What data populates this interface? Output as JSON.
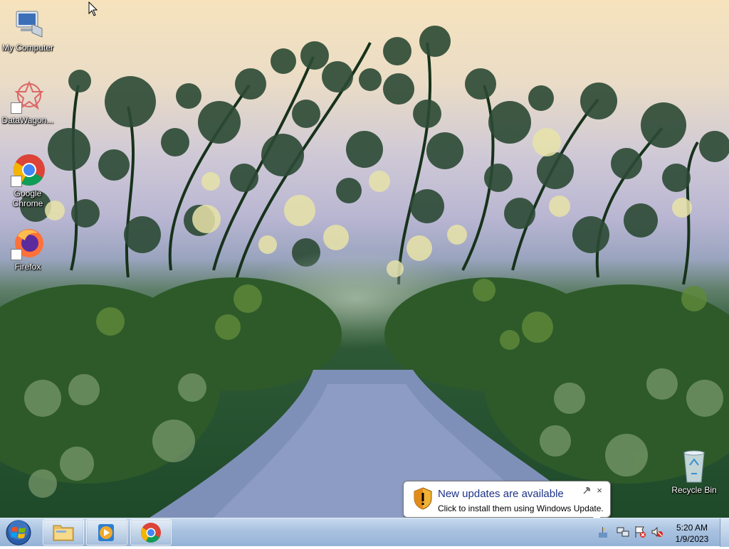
{
  "desktop": {
    "icons": [
      {
        "label": "My Computer",
        "icon": "computer-icon"
      },
      {
        "label": "DataWagon...",
        "icon": "datawagon-icon"
      },
      {
        "label": "Google Chrome",
        "icon": "chrome-icon"
      },
      {
        "label": "Firefox",
        "icon": "firefox-icon"
      },
      {
        "label": "Recycle Bin",
        "icon": "recycle-bin-icon"
      }
    ]
  },
  "taskbar": {
    "start_icon": "windows-start-icon",
    "pinned": [
      {
        "name": "Windows Explorer",
        "icon": "folder-icon"
      },
      {
        "name": "Windows Media Player",
        "icon": "media-player-icon"
      },
      {
        "name": "Google Chrome",
        "icon": "chrome-icon"
      }
    ],
    "tray": {
      "icons": [
        "update-flag-icon",
        "network-icon",
        "action-center-icon",
        "volume-muted-icon"
      ],
      "time": "5:20 AM",
      "date": "1/9/2023"
    }
  },
  "notification": {
    "title": "New updates are available",
    "text": "Click to install them using Windows Update.",
    "icon": "security-shield-icon",
    "close_label": "×"
  },
  "colors": {
    "taskbar": "#a9c2e0",
    "balloon_title": "#1e3287"
  }
}
